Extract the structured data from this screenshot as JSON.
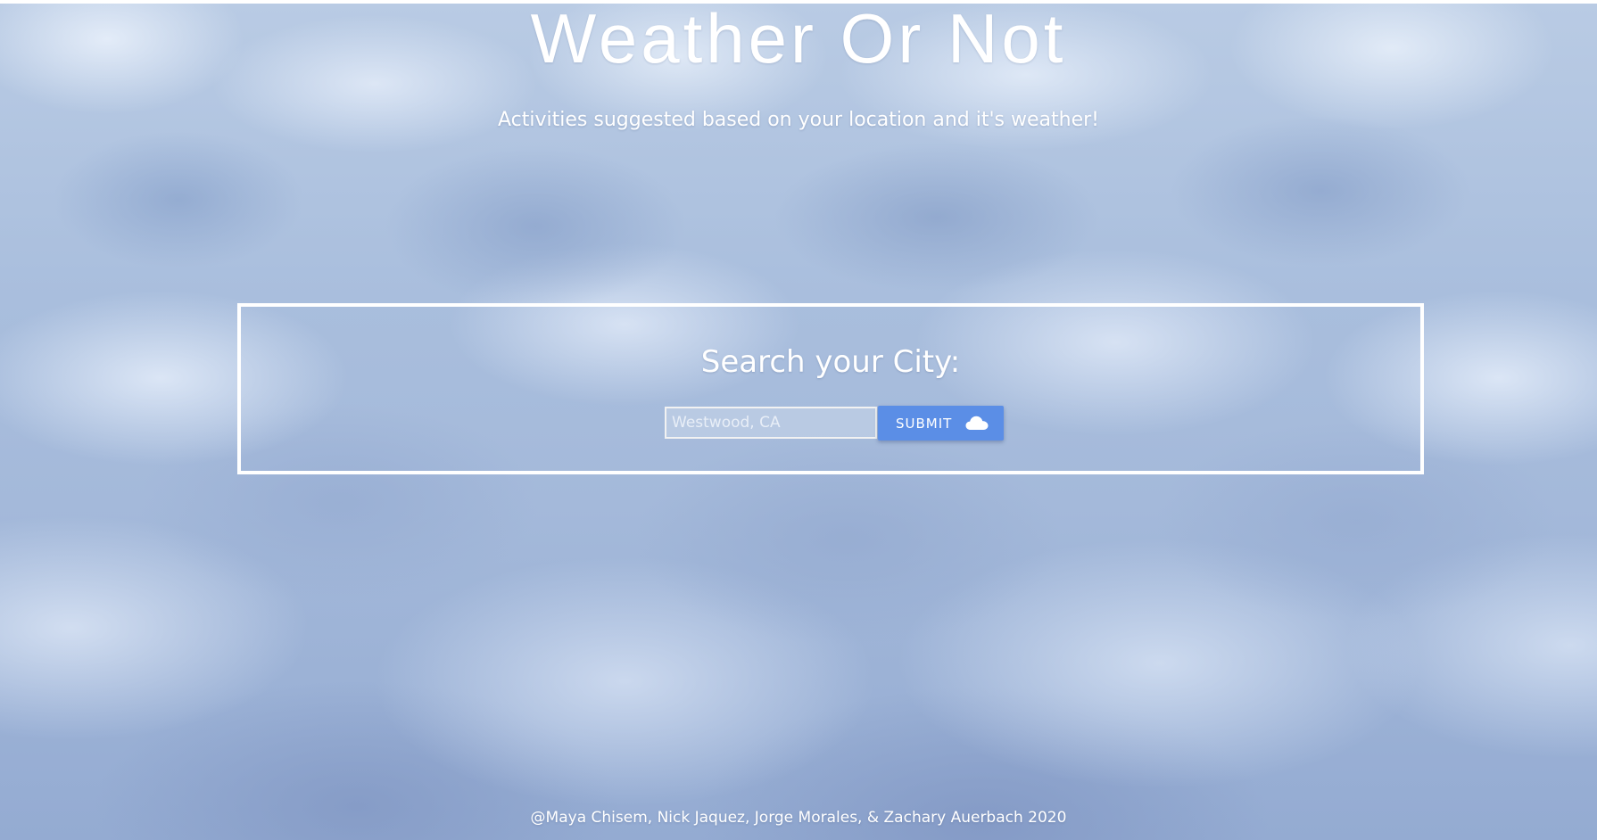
{
  "header": {
    "title": "Weather Or Not",
    "subtitle": "Activities suggested based on your location and it's weather!"
  },
  "search": {
    "heading": "Search your City:",
    "placeholder": "Westwood, CA",
    "value": "",
    "submit_label": "SUBMIT",
    "submit_icon": "cloud-icon"
  },
  "footer": {
    "credits": "@Maya Chisem, Nick Jaquez, Jorge Morales, & Zachary Auerbach 2020"
  },
  "colors": {
    "submit_button": "#5b8ee6",
    "text": "#ffffff",
    "sky": "#a9bedd"
  }
}
